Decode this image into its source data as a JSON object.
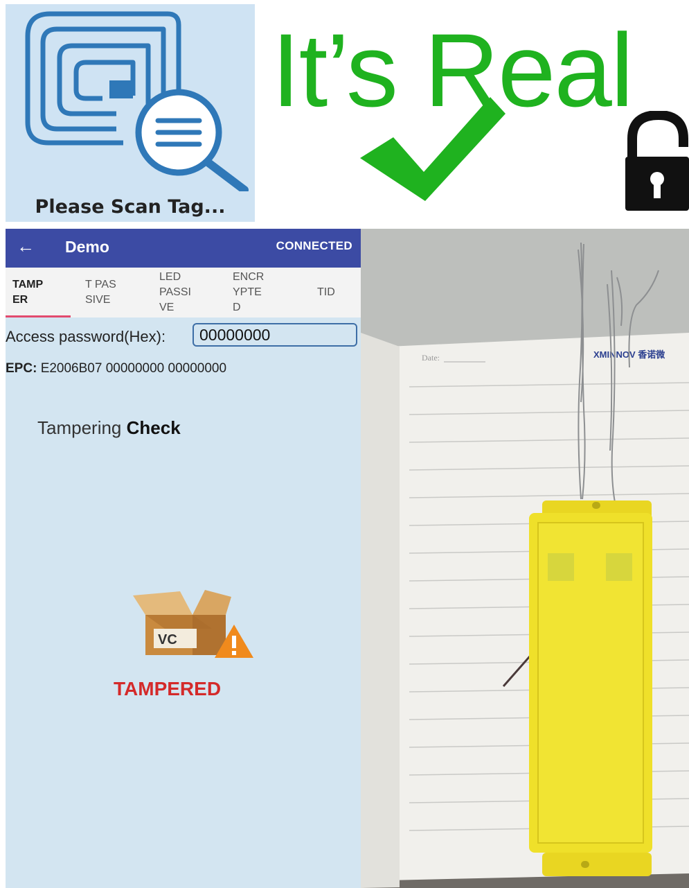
{
  "banner": {
    "scan_caption": "Please Scan Tag...",
    "title": "It’s Real",
    "check_color": "#1fb21f",
    "icons": [
      "rfid-scan-icon",
      "checkmark-icon",
      "unlocked-padlock-icon"
    ]
  },
  "app": {
    "title": "Demo",
    "status": "CONNECTED",
    "tabs": [
      {
        "label": "TAMP\nER",
        "active": true
      },
      {
        "label": "T PAS\nSIVE"
      },
      {
        "label": "LED\nPASSI\nVE"
      },
      {
        "label": "ENCR\nYPTE\nD"
      },
      {
        "label": "TID"
      }
    ],
    "password_label": "Access password(Hex):",
    "password_value": "00000000",
    "epc_label": "EPC:",
    "epc_value": "E2006B07 00000000 00000000",
    "check_title_prefix": "Tampering",
    "check_title_bold": "Check",
    "box_label": "VC",
    "result": "TAMPERED",
    "colors": {
      "app_bar": "#3c4ba4",
      "result": "#d42a2a",
      "tab_indicator": "#e24a6e"
    }
  },
  "photo": {
    "page_date_label": "Date:",
    "brand_text": "XMINNOV 香诺微"
  }
}
